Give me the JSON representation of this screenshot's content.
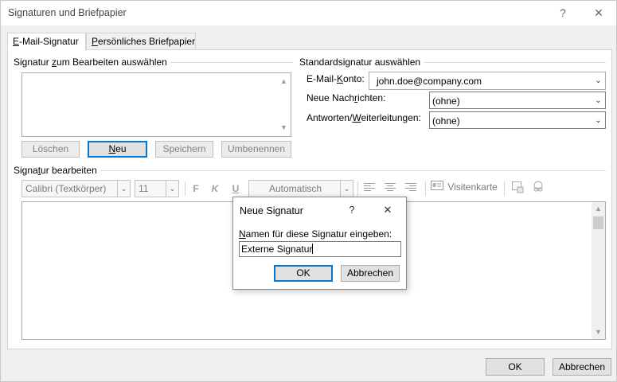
{
  "window": {
    "title": "Signaturen und Briefpapier",
    "help_glyph": "?",
    "close_glyph": "✕"
  },
  "tabs": [
    {
      "label_u": "E",
      "label_rest": "-Mail-Signatur",
      "active": true
    },
    {
      "label_u": "P",
      "label_rest": "ersönliches Briefpapier",
      "active": false
    }
  ],
  "select_section": {
    "label_pre": "Signatur ",
    "label_u": "z",
    "label_post": "um Bearbeiten auswählen"
  },
  "signature_buttons": {
    "delete": "Löschen",
    "new_u": "N",
    "new_rest": "eu",
    "save": "Speichern",
    "rename": "Umbenennen"
  },
  "default_section": {
    "label": "Standardsignatur auswählen",
    "email_account_pre": "E-Mail-",
    "email_account_u": "K",
    "email_account_post": "onto:",
    "email_account_value": "john.doe@company.com",
    "new_messages_pre": "Neue Nach",
    "new_messages_u": "r",
    "new_messages_post": "ichten:",
    "new_messages_value": "(ohne)",
    "replies_pre": "Antworten/",
    "replies_u": "W",
    "replies_post": "eiterleitungen:",
    "replies_value": "(ohne)"
  },
  "edit_section": {
    "label_pre": "Signa",
    "label_u": "t",
    "label_post": "ur bearbeiten"
  },
  "toolbar": {
    "font": "Calibri (Textkörper)",
    "size": "11",
    "bold": "F",
    "italic": "K",
    "underline": "U",
    "color": "Automatisch",
    "business_card": "Visitenkarte"
  },
  "modal": {
    "title": "Neue Signatur",
    "help_glyph": "?",
    "close_glyph": "✕",
    "prompt_u": "N",
    "prompt_rest": "amen für diese Signatur eingeben:",
    "input_value": "Externe Signatur",
    "ok": "OK",
    "cancel": "Abbrechen"
  },
  "footer": {
    "ok": "OK",
    "cancel": "Abbrechen"
  },
  "icons": {
    "chevron_down": "⌄",
    "scroll_up": "▲",
    "scroll_down": "▼"
  }
}
